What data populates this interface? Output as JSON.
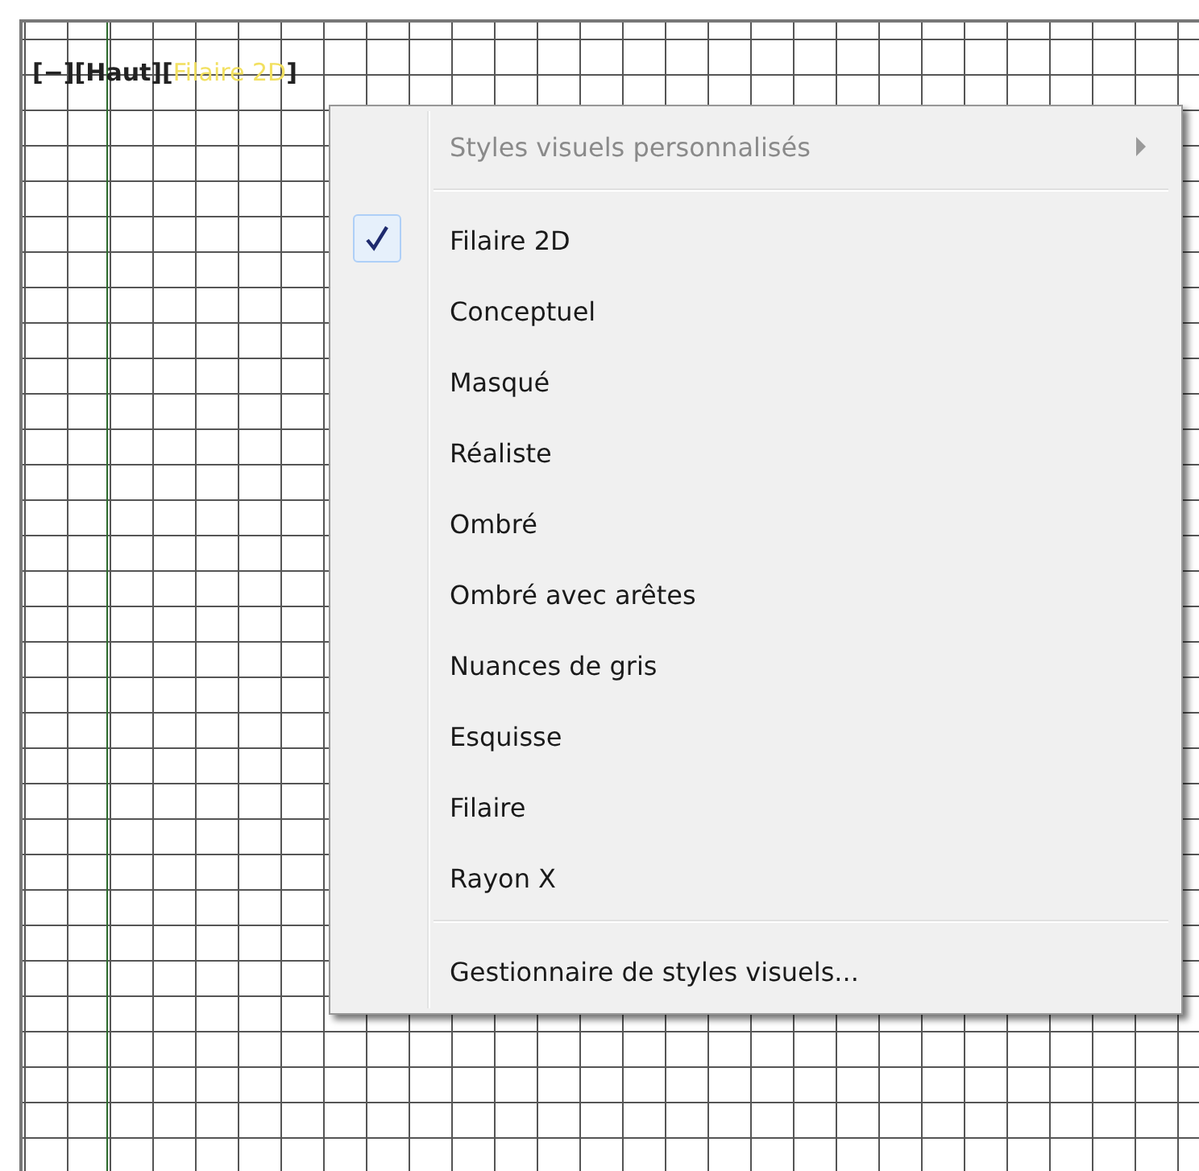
{
  "viewport_label": [
    {
      "text": "[−]",
      "kind": "plain"
    },
    {
      "text": "[Haut]",
      "kind": "plain"
    },
    {
      "text": "[",
      "kind": "plain"
    },
    {
      "text": "Filaire 2D",
      "kind": "highlight"
    },
    {
      "text": "]",
      "kind": "plain"
    }
  ],
  "menu": {
    "items": [
      {
        "kind": "submenu",
        "label": "Styles visuels personnalisés",
        "disabled": true
      },
      {
        "kind": "separator"
      },
      {
        "kind": "option",
        "label": "Filaire 2D",
        "checked": true
      },
      {
        "kind": "option",
        "label": "Conceptuel",
        "checked": false
      },
      {
        "kind": "option",
        "label": "Masqué",
        "checked": false
      },
      {
        "kind": "option",
        "label": "Réaliste",
        "checked": false
      },
      {
        "kind": "option",
        "label": "Ombré",
        "checked": false
      },
      {
        "kind": "option",
        "label": "Ombré avec arêtes",
        "checked": false
      },
      {
        "kind": "option",
        "label": "Nuances de gris",
        "checked": false
      },
      {
        "kind": "option",
        "label": "Esquisse",
        "checked": false
      },
      {
        "kind": "option",
        "label": "Filaire",
        "checked": false
      },
      {
        "kind": "option",
        "label": "Rayon X",
        "checked": false
      },
      {
        "kind": "separator"
      },
      {
        "kind": "command",
        "label": "Gestionnaire de styles visuels..."
      }
    ]
  }
}
